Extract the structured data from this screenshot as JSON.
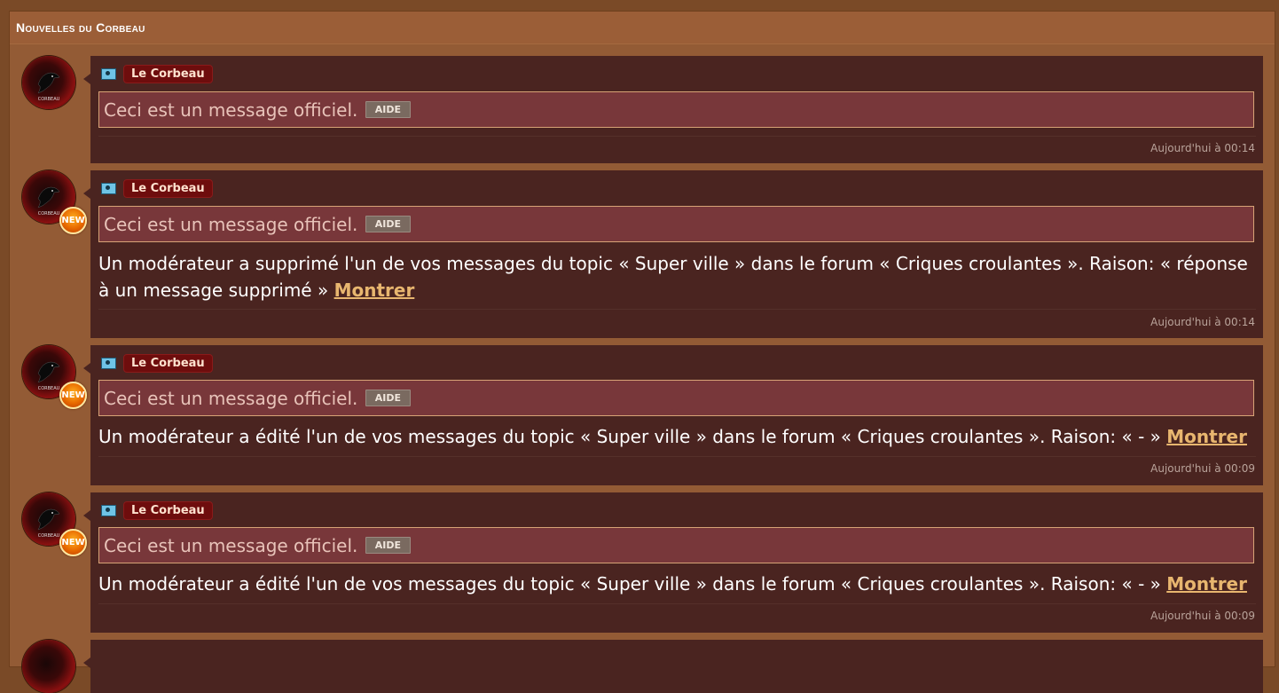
{
  "panel": {
    "title": "Nouvelles du Corbeau"
  },
  "entries": [
    {
      "author": "Le Corbeau",
      "official": "Ceci est un message officiel.",
      "aide": "AIDE",
      "message": "",
      "link": "",
      "time": "Aujourd'hui à 00:14",
      "is_new": false
    },
    {
      "author": "Le Corbeau",
      "official": "Ceci est un message officiel.",
      "aide": "AIDE",
      "message": "Un modérateur a supprimé l'un de vos messages du topic « Super ville » dans le forum « Criques croulantes ». Raison: « réponse à un message supprimé »",
      "link": "Montrer",
      "time": "Aujourd'hui à 00:14",
      "is_new": true
    },
    {
      "author": "Le Corbeau",
      "official": "Ceci est un message officiel.",
      "aide": "AIDE",
      "message": "Un modérateur a édité l'un de vos messages du topic « Super ville » dans le forum « Criques croulantes ». Raison: « - »",
      "link": "Montrer",
      "time": "Aujourd'hui à 00:09",
      "is_new": true
    },
    {
      "author": "Le Corbeau",
      "official": "Ceci est un message officiel.",
      "aide": "AIDE",
      "message": "Un modérateur a édité l'un de vos messages du topic « Super ville » dans le forum « Criques croulantes ». Raison: « - »",
      "link": "Montrer",
      "time": "Aujourd'hui à 00:09",
      "is_new": true
    }
  ],
  "avatar": {
    "caption": "CORBEAU"
  },
  "new_badge": "NEW",
  "icons": {
    "profile": "profile-card-icon",
    "avatar": "raven-icon",
    "badge": "new-badge-icon"
  },
  "colors": {
    "panel": "#935b35",
    "card": "#4a2420",
    "official_box": "#78373a",
    "author_tag": "#6e0d0d",
    "link": "#e8b66f"
  }
}
